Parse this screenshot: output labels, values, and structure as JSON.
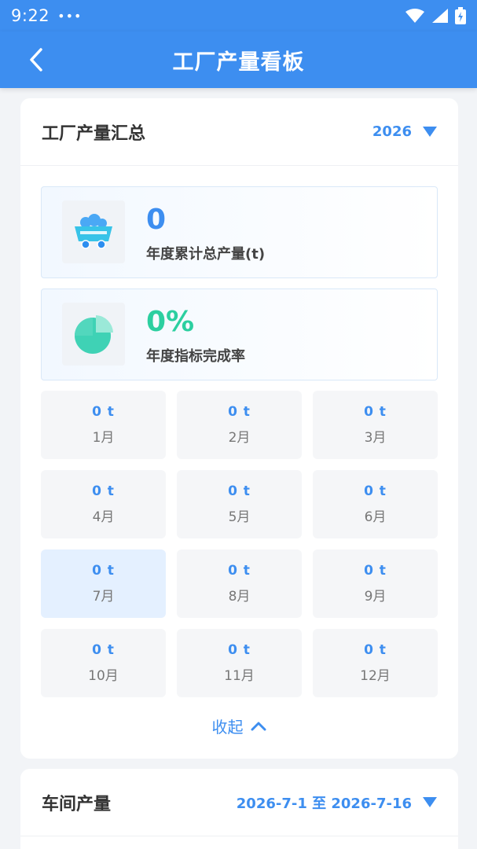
{
  "status_bar": {
    "time": "9:22",
    "dots": "•••"
  },
  "app_bar": {
    "title": "工厂产量看板"
  },
  "summary": {
    "title": "工厂产量汇总",
    "year": "2026",
    "total": {
      "value": "0",
      "label": "年度累计总产量(t)"
    },
    "completion": {
      "value": "0%",
      "label": "年度指标完成率"
    },
    "months": [
      {
        "value": "0 t",
        "name": "1月"
      },
      {
        "value": "0 t",
        "name": "2月"
      },
      {
        "value": "0 t",
        "name": "3月"
      },
      {
        "value": "0 t",
        "name": "4月"
      },
      {
        "value": "0 t",
        "name": "5月"
      },
      {
        "value": "0 t",
        "name": "6月"
      },
      {
        "value": "0 t",
        "name": "7月"
      },
      {
        "value": "0 t",
        "name": "8月"
      },
      {
        "value": "0 t",
        "name": "9月"
      },
      {
        "value": "0 t",
        "name": "10月"
      },
      {
        "value": "0 t",
        "name": "11月"
      },
      {
        "value": "0 t",
        "name": "12月"
      }
    ],
    "collapse_label": "收起"
  },
  "workshop": {
    "title": "车间产量",
    "date_range": "2026-7-1 至 2026-7-16"
  },
  "colors": {
    "primary": "#3d8ef0",
    "teal": "#2ccfa0"
  },
  "icons": [
    "back-icon",
    "wifi-icon",
    "signal-icon",
    "battery-icon",
    "mine-cart-icon",
    "pie-chart-icon",
    "chevron-up-icon",
    "dropdown-triangle-icon"
  ]
}
